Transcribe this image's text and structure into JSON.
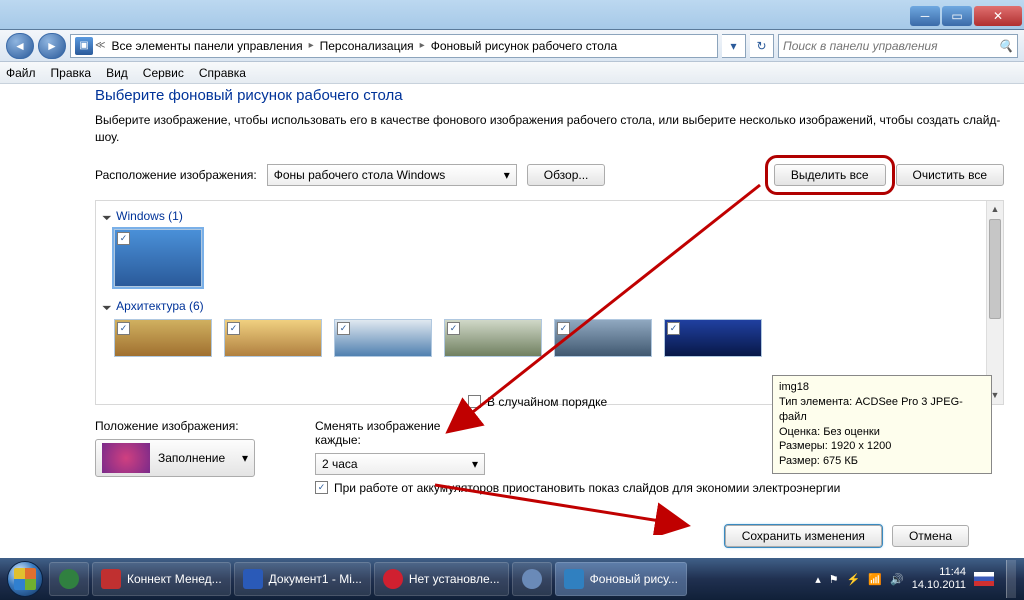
{
  "titlebar": {},
  "nav": {
    "search_placeholder": "Поиск в панели управления",
    "breadcrumb": [
      "Все элементы панели управления",
      "Персонализация",
      "Фоновый рисунок рабочего стола"
    ]
  },
  "menubar": [
    "Файл",
    "Правка",
    "Вид",
    "Сервис",
    "Справка"
  ],
  "page": {
    "title": "Выберите фоновый рисунок рабочего стола",
    "desc": "Выберите изображение, чтобы использовать его в качестве фонового изображения рабочего стола, или выберите несколько изображений, чтобы создать слайд-шоу.",
    "loc_label": "Расположение изображения:",
    "loc_value": "Фоны рабочего стола Windows",
    "browse": "Обзор...",
    "select_all": "Выделить все",
    "clear_all": "Очистить все",
    "groups": [
      {
        "name": "Windows (1)",
        "count": 1
      },
      {
        "name": "Архитектура (6)",
        "count": 6
      }
    ],
    "pos_label": "Положение изображения:",
    "pos_value": "Заполнение",
    "interval_label": "Сменять изображение каждые:",
    "interval_value": "2 часа",
    "shuffle": "В случайном порядке",
    "battery": "При работе от аккумуляторов приостановить показ слайдов для экономии электроэнергии",
    "save": "Сохранить изменения",
    "cancel": "Отмена"
  },
  "tooltip": {
    "name": "img18",
    "type_label": "Тип элемента:",
    "type_value": "ACDSee Pro 3 JPEG-файл",
    "rating_label": "Оценка:",
    "rating_value": "Без оценки",
    "dims_label": "Размеры:",
    "dims_value": "1920 x 1200",
    "size_label": "Размер:",
    "size_value": "675 КБ"
  },
  "taskbar": {
    "items": [
      {
        "label": "",
        "icon": "#308040"
      },
      {
        "label": "Коннект Менед...",
        "icon": "#c03030"
      },
      {
        "label": "Документ1 - Mi...",
        "icon": "#2a5ab8"
      },
      {
        "label": "Нет установле...",
        "icon": "#d02030"
      },
      {
        "label": "",
        "icon": "#6a8ab8"
      },
      {
        "label": "Фоновый рису...",
        "icon": "#3080c0",
        "active": true
      }
    ],
    "time": "11:44",
    "date": "14.10.2011"
  }
}
